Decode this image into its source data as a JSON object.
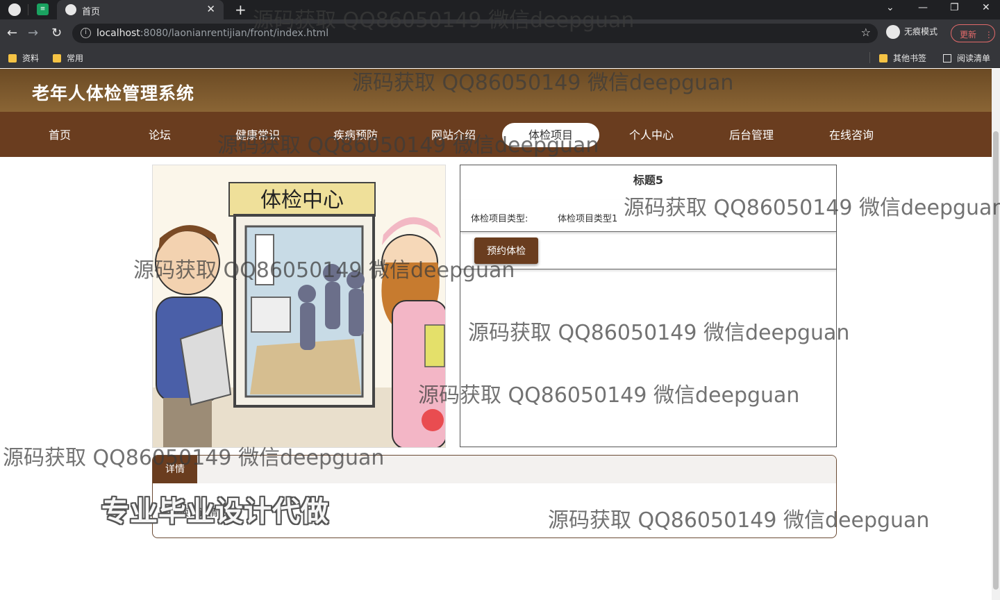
{
  "browser": {
    "tab_title": "首页",
    "new_tab": "+",
    "url_host": "localhost",
    "url_rest": ":8080/laonianrentijian/front/index.html",
    "incognito_label": "无痕模式",
    "update_label": "更新",
    "bookmarks": [
      "资料",
      "常用"
    ],
    "other_bookmarks": "其他书签",
    "reading_list": "阅读清单",
    "icons": [
      "back-icon",
      "forward-icon",
      "reload-icon",
      "info-icon",
      "star-icon",
      "menu-icon"
    ]
  },
  "site": {
    "title": "老年人体检管理系统",
    "nav": [
      {
        "label": "首页"
      },
      {
        "label": "论坛"
      },
      {
        "label": "健康常识"
      },
      {
        "label": "疾病预防"
      },
      {
        "label": "网站介绍"
      },
      {
        "label": "体检项目",
        "active": true
      },
      {
        "label": "个人中心"
      },
      {
        "label": "后台管理"
      },
      {
        "label": "在线咨询"
      }
    ],
    "colors": {
      "header": "#7a5630",
      "nav": "#6a3d1f",
      "button": "#6a3d1f"
    }
  },
  "detail": {
    "title": "标题5",
    "type_label": "体检项目类型:",
    "type_value": "体检项目类型1",
    "book_button": "预约体检",
    "image_text": "体检中心",
    "tab_label": "详情",
    "detail_text": "体检项目详情5"
  },
  "overlay": {
    "promo": "专业毕业设计代做",
    "watermark": "源码获取 QQ86050149 微信deepguan"
  }
}
